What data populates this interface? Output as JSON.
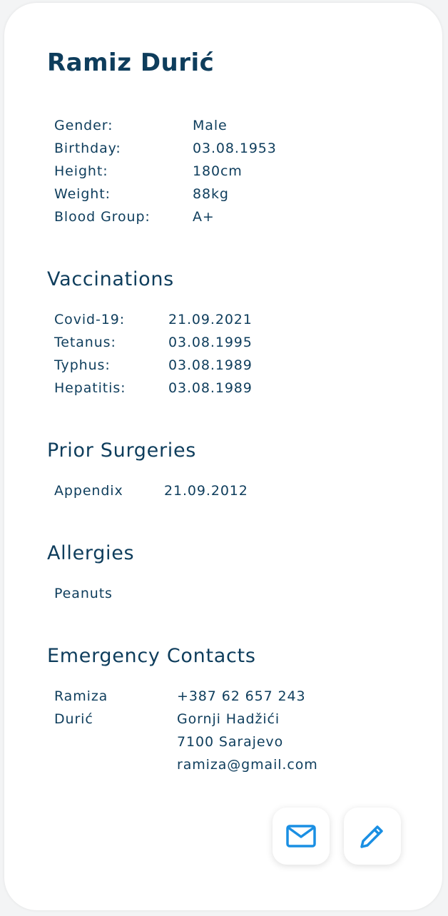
{
  "patient": {
    "name": "Ramiz Durić"
  },
  "info": {
    "gender_label": "Gender:",
    "gender": "Male",
    "birthday_label": "Birthday:",
    "birthday": "03.08.1953",
    "height_label": "Height:",
    "height": "180cm",
    "weight_label": "Weight:",
    "weight": "88kg",
    "blood_label": "Blood Group:",
    "blood": "A+"
  },
  "vaccinations": {
    "title": "Vaccinations",
    "items": [
      {
        "label": "Covid-19:",
        "date": "21.09.2021"
      },
      {
        "label": "Tetanus:",
        "date": "03.08.1995"
      },
      {
        "label": "Typhus:",
        "date": "03.08.1989"
      },
      {
        "label": "Hepatitis:",
        "date": "03.08.1989"
      }
    ]
  },
  "surgeries": {
    "title": "Prior Surgeries",
    "items": [
      {
        "label": "Appendix",
        "date": "21.09.2012"
      }
    ]
  },
  "allergies": {
    "title": "Allergies",
    "items": [
      "Peanuts"
    ]
  },
  "emergency": {
    "title": "Emergency Contacts",
    "first_name": "Ramiza",
    "last_name": "Durić",
    "phone": "+387 62 657 243",
    "street": "Gornji Hadžići",
    "city": "7100 Sarajevo",
    "email": "ramiza@gmail.com"
  },
  "actions": {
    "mail_icon": "mail-icon",
    "edit_icon": "pencil-icon"
  },
  "colors": {
    "text": "#0e3d5c",
    "accent": "#1a8fe3",
    "card": "#ffffff",
    "background": "#f3f4f5"
  }
}
